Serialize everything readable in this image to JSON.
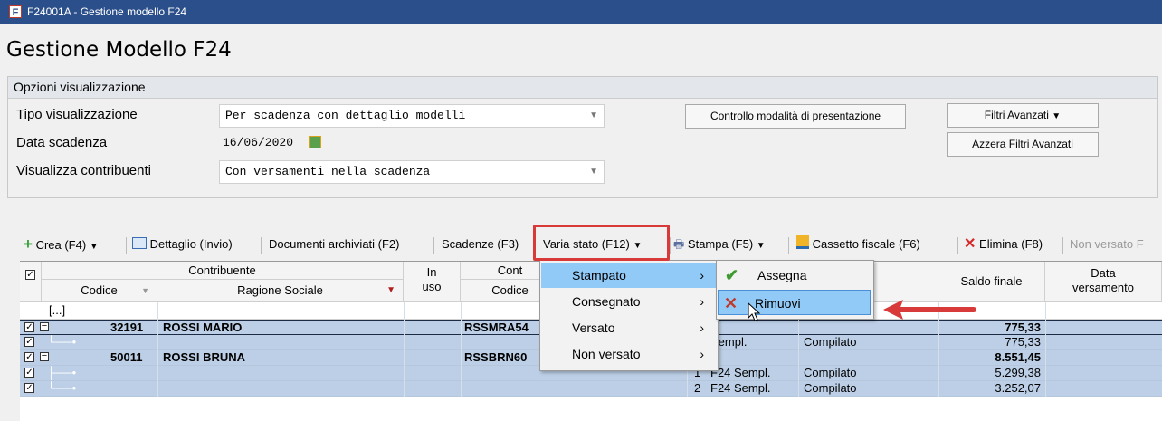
{
  "window": {
    "icon": "F",
    "title": "F24001A - Gestione modello F24"
  },
  "page_title": "Gestione Modello F24",
  "options": {
    "header": "Opzioni visualizzazione",
    "tipo_label": "Tipo visualizzazione",
    "tipo_value": "Per scadenza con dettaglio modelli",
    "data_label": "Data scadenza",
    "data_value": "16/06/2020",
    "contribuenti_label": "Visualizza contribuenti",
    "contribuenti_value": "Con versamenti nella scadenza",
    "controllo_button": "Controllo modalità di presentazione",
    "filtri_button": "Filtri Avanzati",
    "azzera_button": "Azzera Filtri Avanzati"
  },
  "toolbar": {
    "crea": "Crea (F4)",
    "dettaglio": "Dettaglio (Invio)",
    "documenti": "Documenti archiviati (F2)",
    "scadenze": "Scadenze (F3)",
    "varia_stato": "Varia stato (F12)",
    "stampa": "Stampa (F5)",
    "cassetto": "Cassetto fiscale (F6)",
    "elimina": "Elimina (F8)",
    "non_versato": "Non versato F"
  },
  "grid": {
    "group_contribuente": "Contribuente",
    "col_codice": "Codice",
    "col_ragione": "Ragione Sociale",
    "col_in_uso": "In uso",
    "col_cont": "Cont",
    "col_cont_codice": "Codice",
    "col_saldo": "Saldo finale",
    "col_data_versamento": "Data versamento",
    "filter_placeholder": "[...]",
    "rows": [
      {
        "codice": "32191",
        "ragione": "ROSSI MARIO",
        "cf": "RSSMRA54",
        "n": "",
        "tipo": "",
        "stato": "",
        "saldo": "775,33",
        "group": true
      },
      {
        "codice": "",
        "ragione": "",
        "cf": "",
        "n": "",
        "tipo": "Sempl.",
        "stato": "Compilato",
        "saldo": "775,33",
        "group": false
      },
      {
        "codice": "50011",
        "ragione": "ROSSI BRUNA",
        "cf": "RSSBRN60",
        "n": "",
        "tipo": "",
        "stato": "",
        "saldo": "8.551,45",
        "group": true
      },
      {
        "codice": "",
        "ragione": "",
        "cf": "",
        "n": "1",
        "tipo": "F24 Sempl.",
        "stato": "Compilato",
        "saldo": "5.299,38",
        "group": false
      },
      {
        "codice": "",
        "ragione": "",
        "cf": "",
        "n": "2",
        "tipo": "F24 Sempl.",
        "stato": "Compilato",
        "saldo": "3.252,07",
        "group": false
      }
    ]
  },
  "menu": {
    "items": [
      "Stampato",
      "Consegnato",
      "Versato",
      "Non versato"
    ],
    "submenu": [
      "Assegna",
      "Rimuovi"
    ]
  },
  "colors": {
    "titlebar": "#2b4f8a",
    "selection": "#bccfe6",
    "menu_highlight": "#91c9f7",
    "annotation": "#d83a3a"
  }
}
